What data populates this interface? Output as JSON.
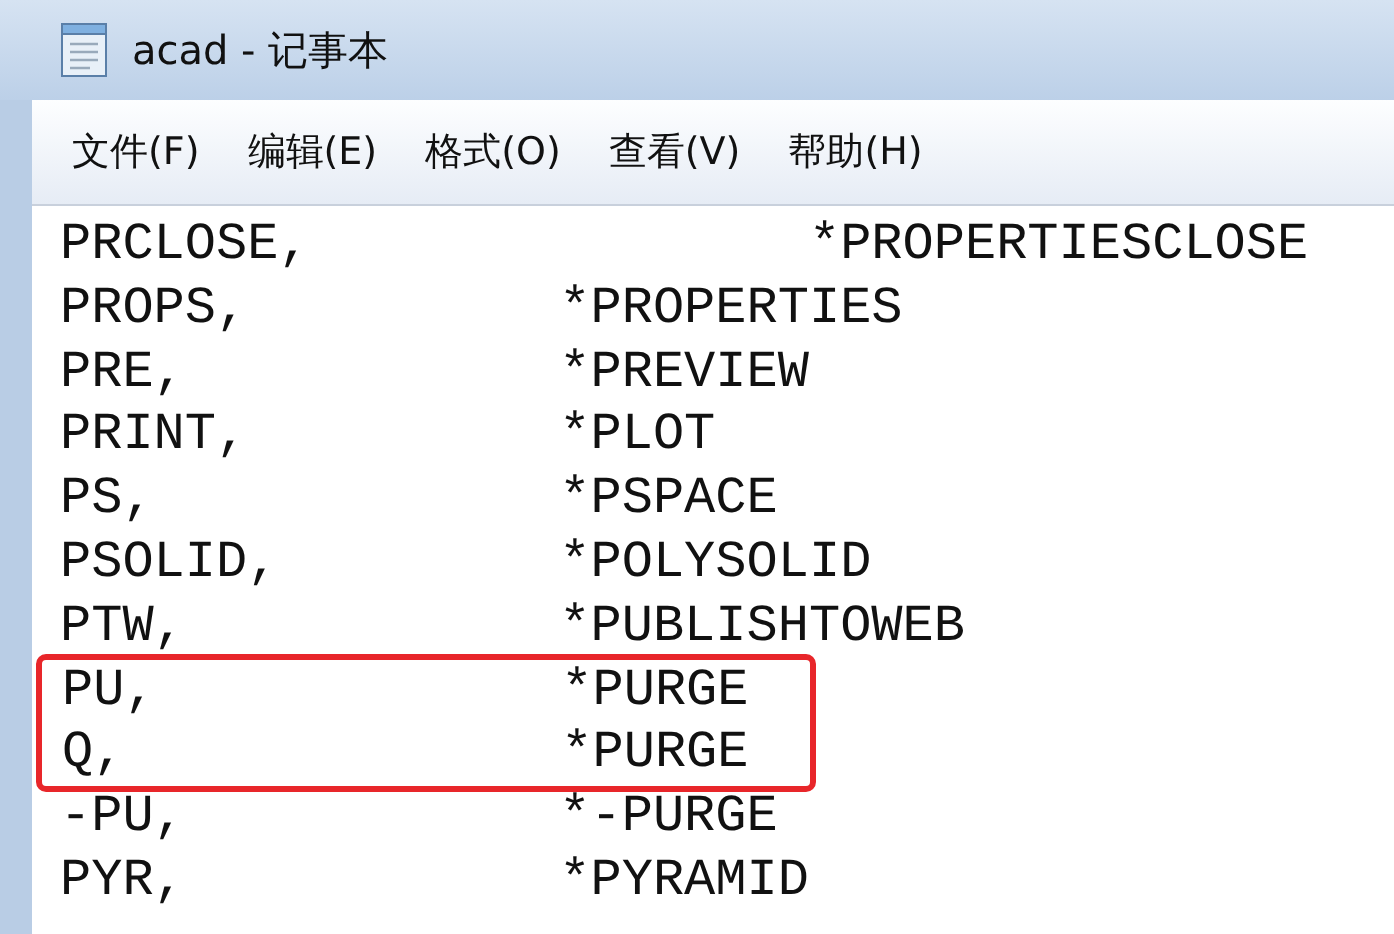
{
  "window": {
    "title": "acad - 记事本"
  },
  "menu": [
    {
      "label": "文件(F)"
    },
    {
      "label": "编辑(E)"
    },
    {
      "label": "格式(O)"
    },
    {
      "label": "查看(V)"
    },
    {
      "label": "帮助(H)"
    }
  ],
  "lines": [
    {
      "text": "PRCLOSE,\t\t*PROPERTIESCLOSE",
      "highlighted": false
    },
    {
      "text": "PROPS,\t\t*PROPERTIES",
      "highlighted": false
    },
    {
      "text": "PRE,\t\t*PREVIEW",
      "highlighted": false
    },
    {
      "text": "PRINT,\t\t*PLOT",
      "highlighted": false
    },
    {
      "text": "PS,\t\t*PSPACE",
      "highlighted": false
    },
    {
      "text": "PSOLID,\t\t*POLYSOLID",
      "highlighted": false
    },
    {
      "text": "PTW,\t\t*PUBLISHTOWEB",
      "highlighted": false
    },
    {
      "text": "PU,\t\t*PURGE",
      "highlighted": true
    },
    {
      "text": "Q,\t\t*PURGE",
      "highlighted": true
    },
    {
      "text": "-PU,\t\t*-PURGE",
      "highlighted": false
    },
    {
      "text": "PYR,\t\t*PYRAMID",
      "highlighted": false
    }
  ]
}
